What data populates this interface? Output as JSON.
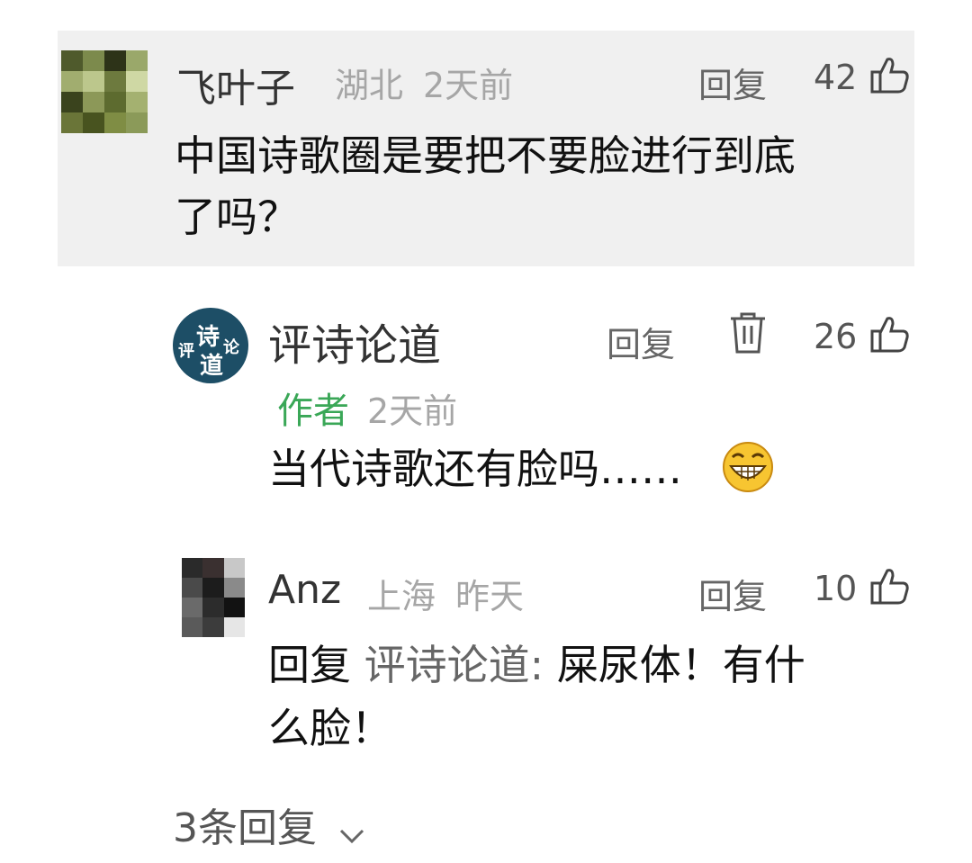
{
  "comment1": {
    "user": "飞叶子",
    "location": "湖北",
    "time": "2天前",
    "reply_label": "回复",
    "likes": "42",
    "text_line1": "中国诗歌圈是要把不要脸进行到底",
    "text_line2": "了吗？"
  },
  "comment2": {
    "avatar_text": [
      "评",
      "诗",
      "论",
      "道"
    ],
    "user": "评诗论道",
    "reply_label": "回复",
    "likes": "26",
    "author_badge": "作者",
    "time": "2天前",
    "text": "当代诗歌还有脸吗……",
    "emoji": "grinning-face"
  },
  "comment3": {
    "user": "Anz",
    "location": "上海",
    "time": "昨天",
    "reply_label": "回复",
    "likes": "10",
    "reply_prefix": "回复",
    "reply_to": "评诗论道:",
    "text_line1": "屎尿体！有什",
    "text_line2": "么脸！"
  },
  "footer": {
    "more_replies": "3条回复"
  }
}
